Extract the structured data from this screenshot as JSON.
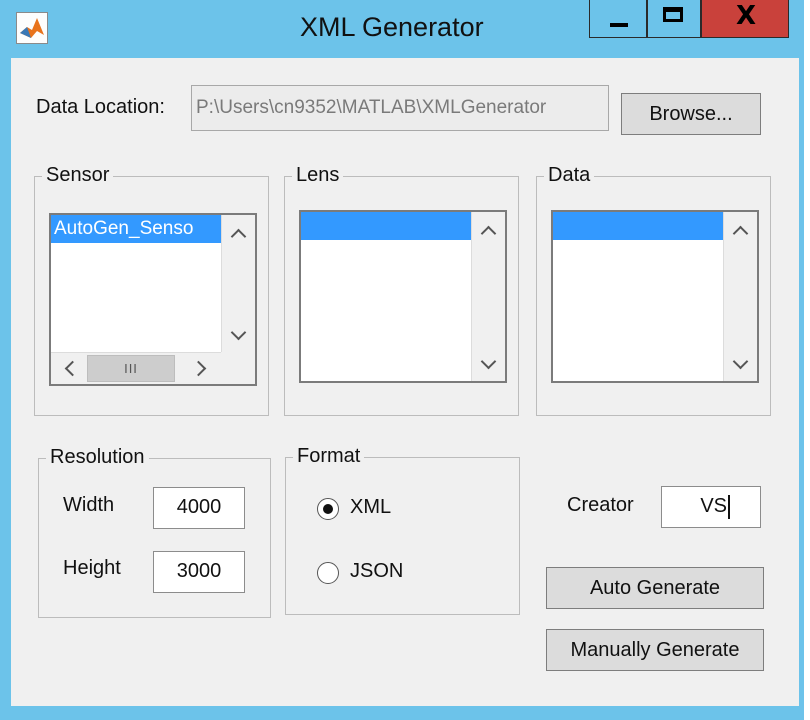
{
  "window": {
    "title": "XML Generator",
    "app_icon": "matlab-icon",
    "close_glyph": "X"
  },
  "data_location": {
    "label": "Data Location:",
    "path": "P:\\Users\\cn9352\\MATLAB\\XMLGenerator",
    "browse_label": "Browse..."
  },
  "sensor": {
    "title": "Sensor",
    "items": [
      "AutoGen_Senso"
    ],
    "hscroll_thumb": "III"
  },
  "lens": {
    "title": "Lens",
    "items": []
  },
  "data_panel": {
    "title": "Data",
    "items": []
  },
  "resolution": {
    "title": "Resolution",
    "width_label": "Width",
    "width_value": "4000",
    "height_label": "Height",
    "height_value": "3000"
  },
  "format": {
    "title": "Format",
    "options": [
      {
        "label": "XML",
        "selected": true
      },
      {
        "label": "JSON",
        "selected": false
      }
    ]
  },
  "creator": {
    "label": "Creator",
    "value": "VS"
  },
  "buttons": {
    "auto_generate": "Auto Generate",
    "manual_generate": "Manually Generate"
  }
}
